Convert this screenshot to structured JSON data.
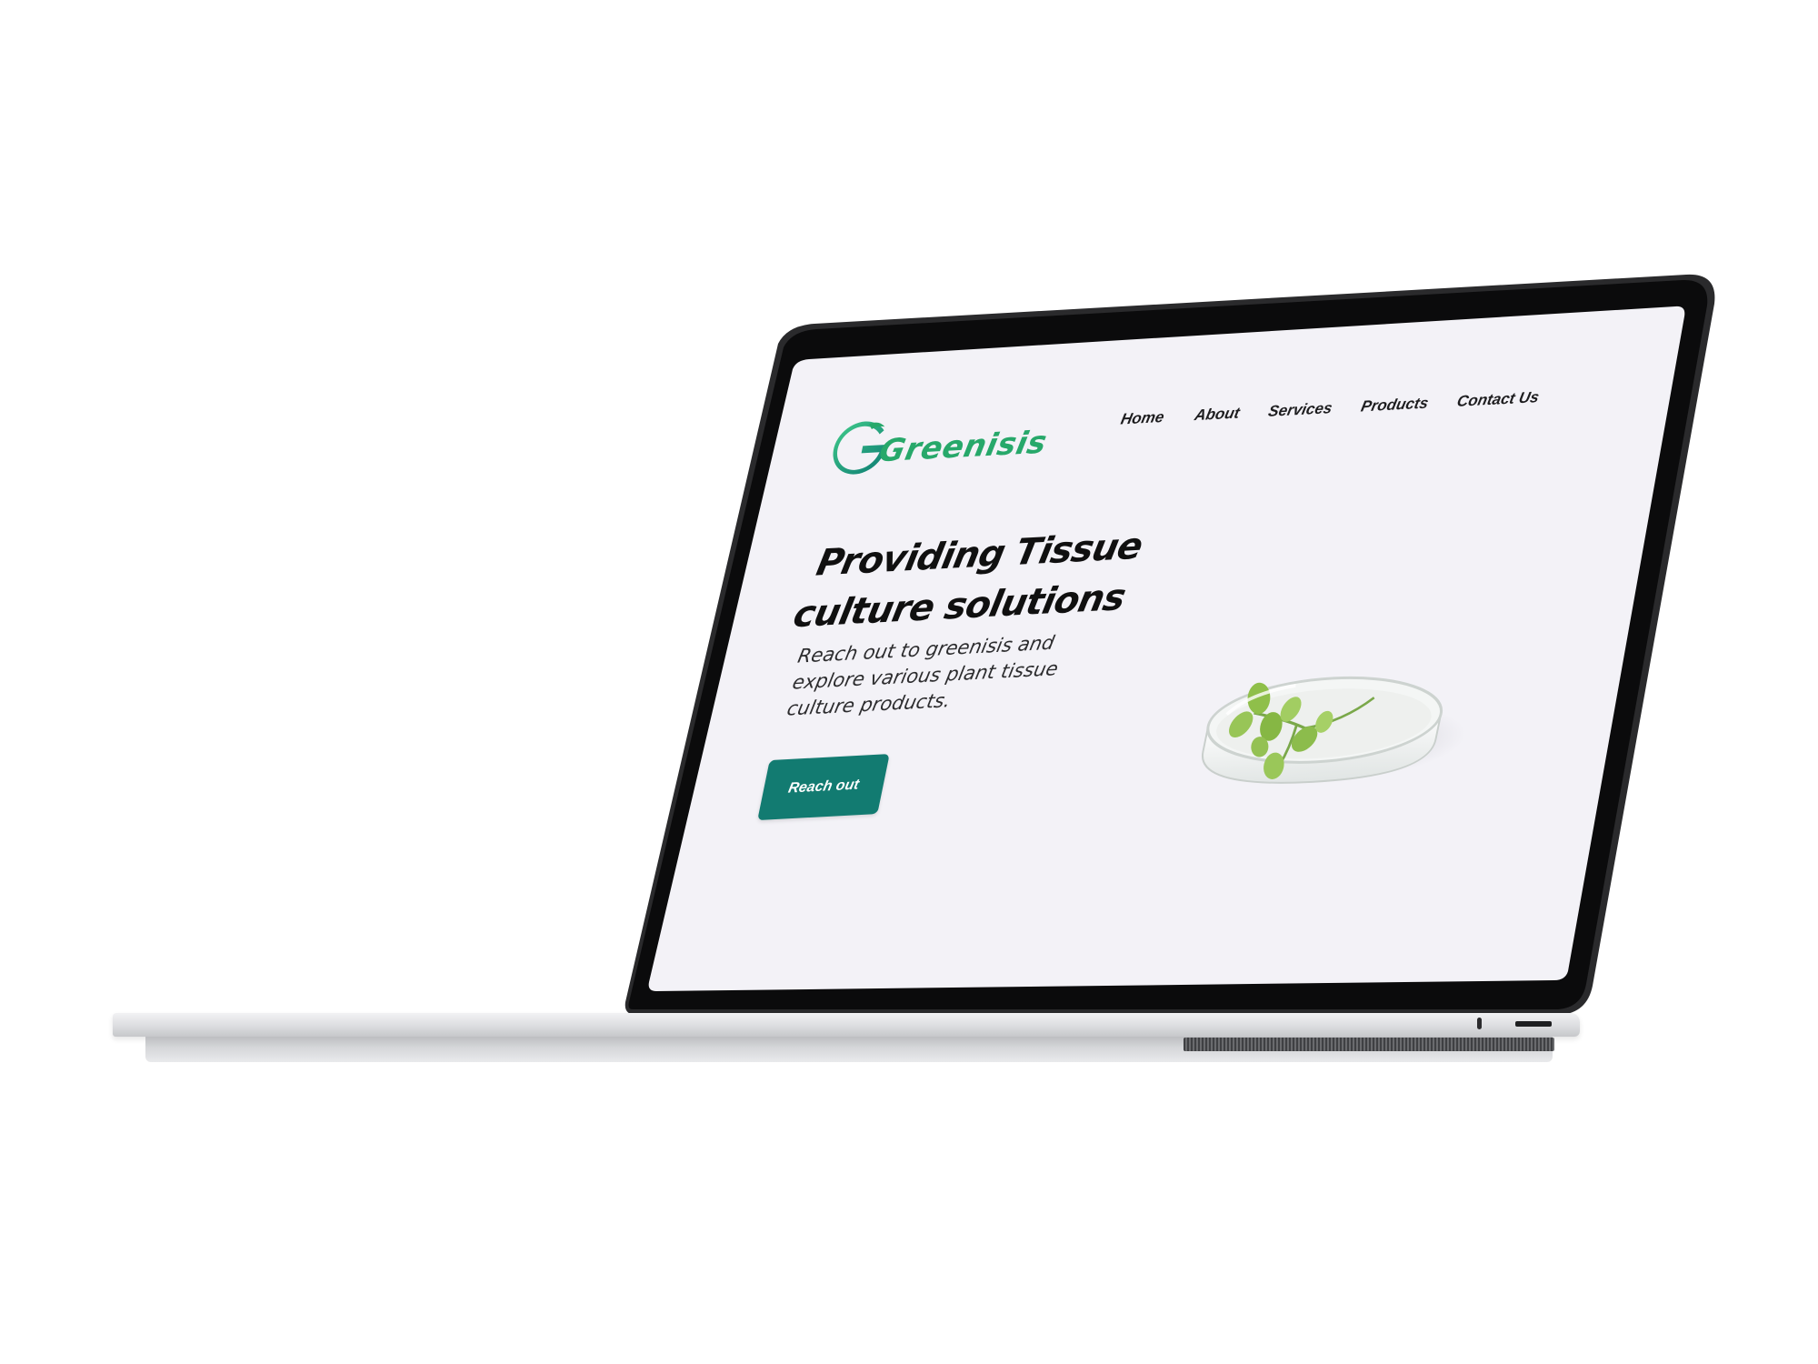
{
  "site": {
    "logo_text": "Greenisis"
  },
  "nav": {
    "items": [
      {
        "label": "Home"
      },
      {
        "label": "About"
      },
      {
        "label": "Services"
      },
      {
        "label": "Products"
      },
      {
        "label": "Contact Us"
      }
    ]
  },
  "hero": {
    "title_line1": "Providing Tissue",
    "title_line2": "culture solutions",
    "subtitle": "Reach out to greenisis and explore various plant tissue culture products.",
    "cta_label": "Reach out"
  },
  "colors": {
    "brand_green": "#27a86a",
    "brand_teal": "#127b71",
    "screen_background": "#f3f2f7",
    "bezel": "#0b0b0c"
  },
  "icons": {
    "logo_mark": "greenisis-g-logo-icon",
    "hero_image": "petri-dish-plantlet-image"
  }
}
